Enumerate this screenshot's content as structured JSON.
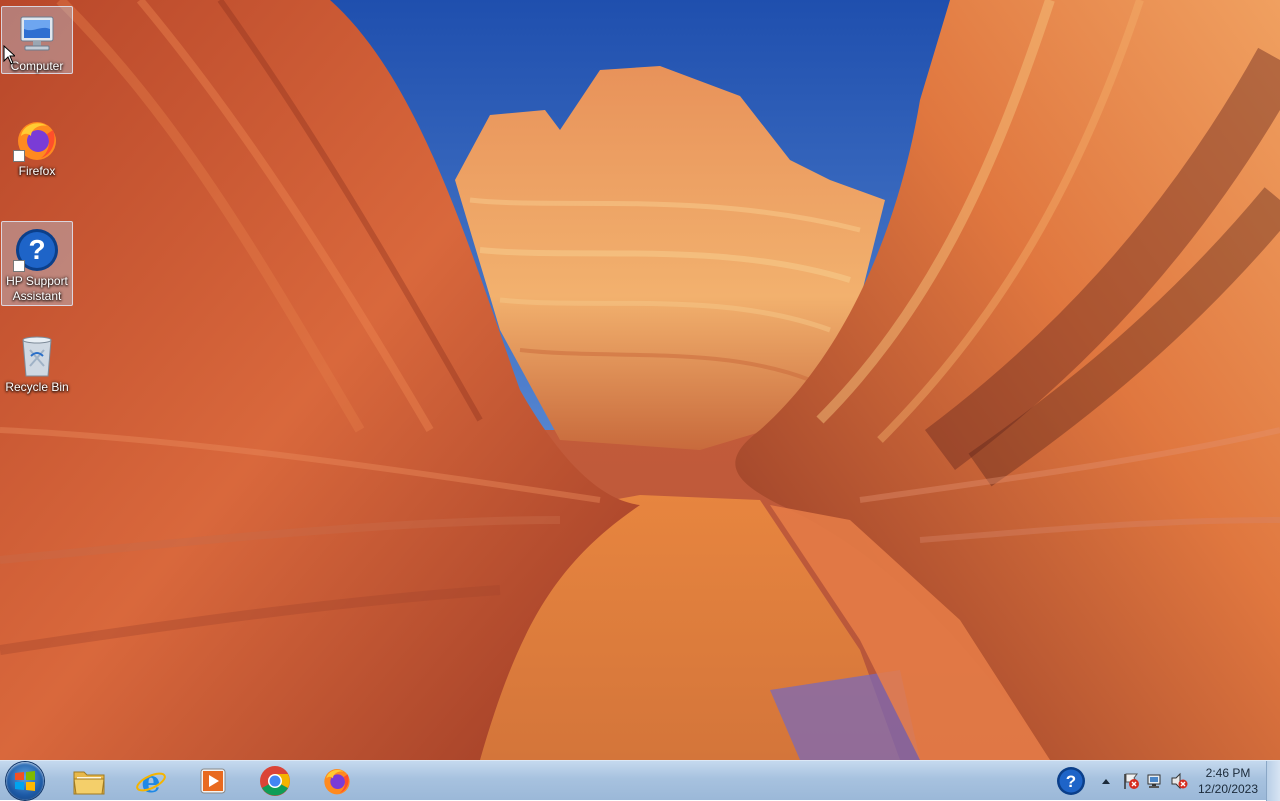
{
  "desktop": {
    "icons": [
      {
        "label": "Computer",
        "icon": "computer-icon",
        "selected": true
      },
      {
        "label": "Firefox",
        "icon": "firefox-icon",
        "shortcut": true
      },
      {
        "label": "HP Support Assistant",
        "icon": "help-question-icon",
        "shortcut": true,
        "selected": true
      },
      {
        "label": "Recycle Bin",
        "icon": "recycle-bin-icon"
      }
    ]
  },
  "taskbar": {
    "start": {
      "icon": "windows-start-icon"
    },
    "pinned": [
      {
        "name": "File Explorer",
        "icon": "folder-icon"
      },
      {
        "name": "Internet Explorer",
        "icon": "internet-explorer-icon"
      },
      {
        "name": "Windows Media Player",
        "icon": "media-player-icon"
      },
      {
        "name": "Google Chrome",
        "icon": "chrome-icon"
      },
      {
        "name": "Firefox",
        "icon": "firefox-icon"
      }
    ],
    "tray": {
      "icons": [
        "hp-support-icon",
        "show-hidden-icons-arrow",
        "action-center-flag-icon",
        "network-icon",
        "volume-muted-icon"
      ],
      "time": "2:46 PM",
      "date": "12/20/2023"
    }
  },
  "colors": {
    "taskbar": "#a7c2df",
    "sky": "#2a5cb8",
    "rock": "#d4633a"
  }
}
